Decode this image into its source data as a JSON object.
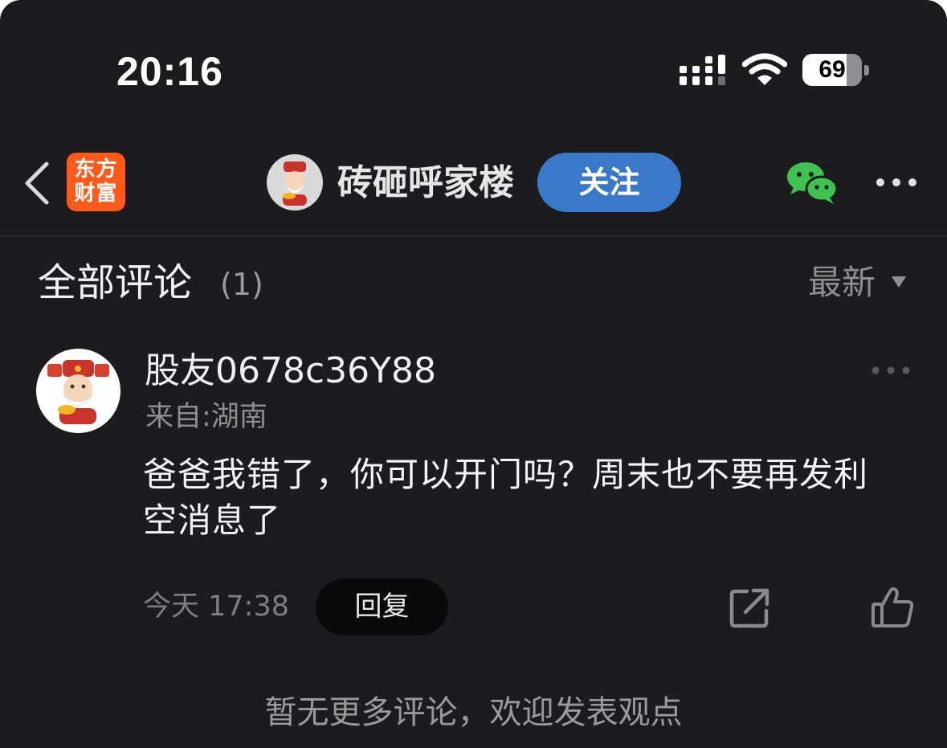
{
  "status_bar": {
    "time": "20:16",
    "battery_level": "69"
  },
  "nav": {
    "logo_line1": "东方",
    "logo_line2": "财富",
    "title": "砖砸呼家楼",
    "follow_label": "关注"
  },
  "section": {
    "title": "全部评论",
    "count": "(1)",
    "sort_label": "最新"
  },
  "comment": {
    "username": "股友0678c36Y88",
    "location": "来自:湖南",
    "text": "爸爸我错了，你可以开门吗？周末也不要再发利空消息了",
    "time": "今天 17:38",
    "reply_label": "回复"
  },
  "footer": {
    "text": "暂无更多评论，欢迎发表观点"
  },
  "colors": {
    "background": "#1c1c1e",
    "follow_button": "#3a78c9",
    "logo": "#ff5a1a",
    "wechat": "#3fc24f"
  },
  "icons": {
    "back": "chevron-left-icon",
    "wechat": "wechat-icon",
    "more": "ellipsis-icon",
    "share": "share-icon",
    "like": "thumbs-up-icon"
  }
}
